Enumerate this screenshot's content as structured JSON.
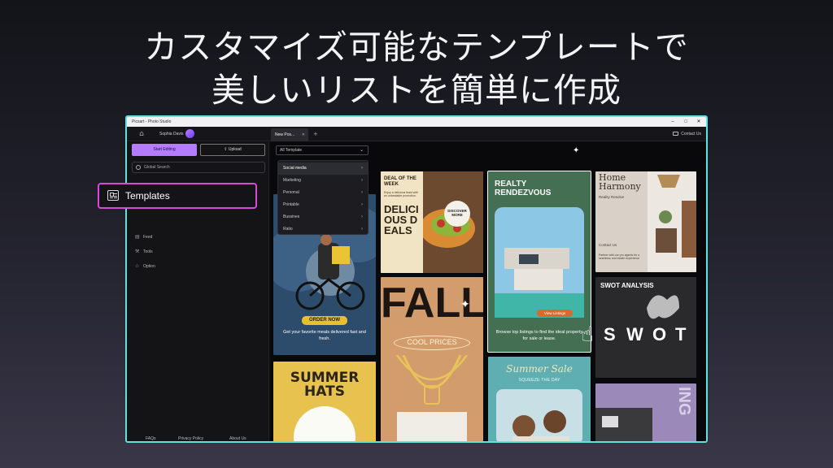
{
  "headline": {
    "line1": "カスタマイズ可能なテンプレートで",
    "line2": "美しいリストを簡単に作成"
  },
  "window": {
    "title": "Picsart - Photo Studio",
    "username": "Sophia Davis",
    "tab_label": "New Pos...",
    "tab_add": "+",
    "contact_label": "Contact Us"
  },
  "sidebar": {
    "start_editing": "Start Editing",
    "upload": "Upload",
    "search_placeholder": "Global Search",
    "items": [
      {
        "label": "Feed",
        "icon": "feed-icon"
      },
      {
        "label": "Tools",
        "icon": "tools-icon"
      },
      {
        "label": "Option",
        "icon": "star-icon"
      }
    ],
    "footer": [
      "FAQs",
      "Privacy Policy",
      "About Us"
    ]
  },
  "callout": {
    "label": "Templates",
    "icon": "templates-icon"
  },
  "filter": {
    "selected": "All Template",
    "options": [
      "Social media",
      "Marketing",
      "Personal",
      "Printable",
      "Bussines",
      "Ratio"
    ]
  },
  "cards": {
    "food": {
      "top": "DEAL OF THE WEEK",
      "sub": "Enjoy a delicious feast with an unbeatable promotion.",
      "big": "DELICIOUS DEALS",
      "badge": "DISCOVER MORE"
    },
    "delivery": {
      "cta": "ORDER NOW",
      "text": "Get your favorite meals delivered fast and fresh."
    },
    "fall": {
      "big": "FALL",
      "sub": "COOL PRICES"
    },
    "hats": {
      "big": "SUMMER HATS"
    },
    "realty": {
      "title": "REALTY RENDEZVOUS",
      "cta": "View Listings",
      "text": "Browse top listings to find the ideal property for sale or lease."
    },
    "summer_sale": {
      "title": "Summer Sale",
      "sub": "SQUEEZE THE DAY"
    },
    "home": {
      "title": "Home Harmony",
      "sub": "Reality Resolve",
      "contact": "Contact Us",
      "text": "Partner with our pro agents for a seamless real estate experience"
    },
    "swot": {
      "title": "SWOT ANALYSIS",
      "letters": [
        "S",
        "W",
        "O",
        "T"
      ]
    },
    "ing": {
      "big": "ING"
    }
  },
  "colors": {
    "window_border": "#5ee1e0",
    "accent_purple": "#b57cff",
    "callout_border": "#d64ad8"
  }
}
